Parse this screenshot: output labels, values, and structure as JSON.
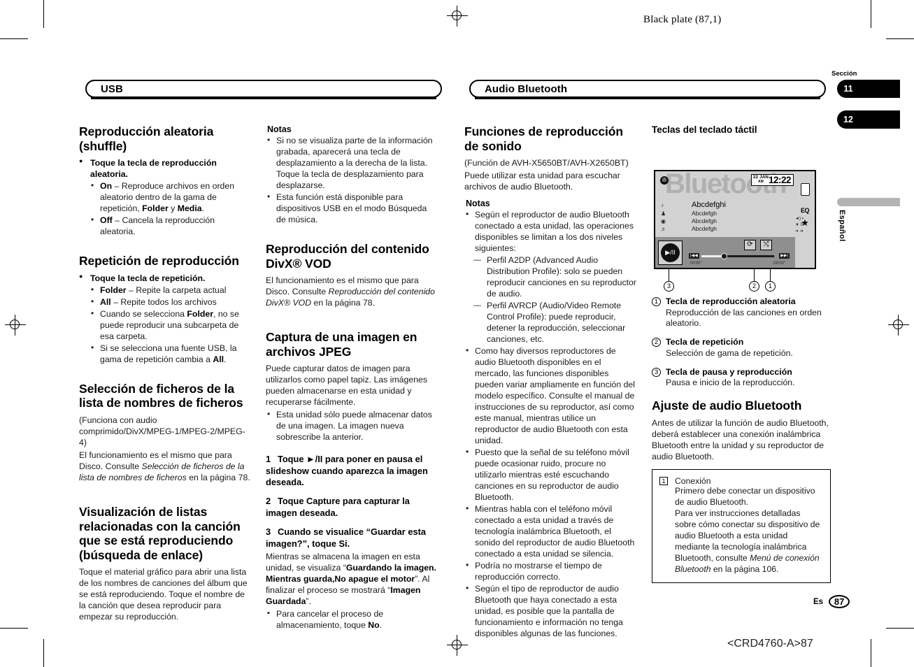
{
  "print": {
    "plate": "Black plate (87,1)",
    "footer_code": "<CRD4760-A>87"
  },
  "margin": {
    "seccion_label": "Sección",
    "tabs": [
      "11",
      "12"
    ],
    "language": "Español"
  },
  "page_footer": {
    "lang": "Es",
    "number": "87"
  },
  "banners": {
    "left": "USB",
    "right": "Audio Bluetooth"
  },
  "col1": {
    "h_shuffle": "Reproducción aleatoria (shuffle)",
    "shuffle_bullet": "Toque la tecla de reproducción aleatoria.",
    "shuffle_on_bold": "On",
    "shuffle_on_rest": " – Reproduce archivos en orden aleatorio dentro de la gama de repetición, ",
    "shuffle_on_b2": "Folder",
    "shuffle_on_mid": " y ",
    "shuffle_on_b3": "Media",
    "shuffle_on_end": ".",
    "shuffle_off_bold": "Off",
    "shuffle_off_rest": " – Cancela la reproducción aleatoria.",
    "h_repeat": "Repetición de reproducción",
    "repeat_bullet": "Toque la tecla de repetición.",
    "rep_folder_b": "Folder",
    "rep_folder_r": " – Repite la carpeta actual",
    "rep_all_b": "All",
    "rep_all_r": " – Repite todos los archivos",
    "rep_note1_a": "Cuando se selecciona ",
    "rep_note1_b": "Folder",
    "rep_note1_c": ", no se puede reproducir una subcarpeta de esa carpeta.",
    "rep_note2_a": "Si se selecciona una fuente USB, la gama de repetición cambia a ",
    "rep_note2_b": "All",
    "rep_note2_c": ".",
    "h_select": "Selección de ficheros de la lista de nombres de ficheros",
    "select_p1": "(Funciona con audio comprimido/DivX/MPEG-1/MPEG-2/MPEG-4)",
    "select_p2": "El funcionamiento es el mismo que para Disco. Consulte ",
    "select_p2_it": "Selección de ficheros de la lista de nombres de ficheros",
    "select_p2_end": " en la página 78.",
    "h_link": "Visualización de listas relacionadas con la canción que se está reproduciendo (búsqueda de enlace)",
    "link_p": "Toque el material gráfico para abrir una lista de los nombres de canciones del álbum que se está reproduciendo. Toque el nombre de la canción que desea reproducir para empezar su reproducción."
  },
  "col2": {
    "notas": "Notas",
    "note1": "Si no se visualiza parte de la información grabada, aparecerá una tecla de desplazamiento a la derecha de la lista. Toque la tecla de desplazamiento para desplazarse.",
    "note2": "Esta función está disponible para dispositivos USB en el modo Búsqueda de música.",
    "h_divx": "Reproducción del contenido DivX® VOD",
    "divx_p_a": "El funcionamiento es el mismo que para Disco. Consulte ",
    "divx_p_it": "Reproducción del contenido DivX® VOD",
    "divx_p_end": " en la página 78.",
    "h_jpeg": "Captura de una imagen en archivos JPEG",
    "jpeg_p": "Puede capturar datos de imagen para utilizarlos como papel tapiz. Las imágenes pueden almacenarse en esta unidad y recuperarse fácilmente.",
    "jpeg_bullet": "Esta unidad sólo puede almacenar datos de una imagen. La imagen nueva sobrescribe la anterior.",
    "step1_num": "1",
    "step1": "Toque ►/II para poner en pausa el slideshow cuando aparezca la imagen deseada.",
    "step2_num": "2",
    "step2": "Toque Capture para capturar la imagen deseada.",
    "step3_num": "3",
    "step3": "Cuando se visualice “Guardar esta imagen?”, toque Si.",
    "step3_p_a": "Mientras se almacena la imagen en esta unidad, se visualiza “",
    "step3_p_b": "Guardando la imagen. Mientras guarda,No apague el motor",
    "step3_p_c": "”. Al finalizar el proceso se mostrará “",
    "step3_p_d": "Imagen Guardada",
    "step3_p_e": "”.",
    "step3_cancel_a": "Para cancelar el proceso de almacenamiento, toque ",
    "step3_cancel_b": "No",
    "step3_cancel_c": "."
  },
  "col3": {
    "h_sound": "Funciones de reproducción de sonido",
    "sound_p1": "(Función de AVH-X5650BT/AVH-X2650BT)",
    "sound_p2": "Puede utilizar esta unidad para escuchar archivos de audio Bluetooth.",
    "notas": "Notas",
    "note1": "Según el reproductor de audio Bluetooth conectado a esta unidad, las operaciones disponibles se limitan a los dos niveles siguientes:",
    "note1_dash1": "Perfil A2DP (Advanced Audio Distribution Profile): solo se pueden reproducir canciones en su reproductor de audio.",
    "note1_dash2": "Perfil AVRCP (Audio/Video Remote Control Profile): puede reproducir, detener la reproducción, seleccionar canciones, etc.",
    "note2": "Como hay diversos reproductores de audio Bluetooth disponibles en el mercado, las funciones disponibles pueden variar ampliamente en función del modelo específico. Consulte el manual de instrucciones de su reproductor, así como este manual, mientras utilice un reproductor de audio Bluetooth con esta unidad.",
    "note3": "Puesto que la señal de su teléfono móvil puede ocasionar ruido, procure no utilizarlo mientras esté escuchando canciones en su reproductor de audio Bluetooth.",
    "note4": "Mientras habla con el teléfono móvil conectado a esta unidad a través de tecnología inalámbrica Bluetooth, el sonido del reproductor de audio Bluetooth conectado a esta unidad se silencia.",
    "note5": "Podría no mostrarse el tiempo de reproducción correcto.",
    "note6": "Según el tipo de reproductor de audio Bluetooth que haya conectado a esta unidad, es posible que la pantalla de funcionamiento e información no tenga disponibles algunas de las funciones."
  },
  "col4": {
    "h_keys": "Teclas del teclado táctil",
    "callouts": [
      {
        "num": "①",
        "title": "Tecla de reproducción aleatoria",
        "desc": "Reproducción de las canciones en orden aleatorio."
      },
      {
        "num": "②",
        "title": "Tecla de repetición",
        "desc": "Selección de gama de repetición."
      },
      {
        "num": "③",
        "title": "Tecla de pausa y reproducción",
        "desc": "Pausa e inicio de la reproducción."
      }
    ],
    "h_adjust": "Ajuste de audio Bluetooth",
    "adjust_p": "Antes de utilizar la función de audio Bluetooth, deberá establecer una conexión inalámbrica Bluetooth entre la unidad y su reproductor de audio Bluetooth.",
    "box_num": "1",
    "box_title": "Conexión",
    "box_p1": "Primero debe conectar un dispositivo de audio Bluetooth.",
    "box_p2_a": "Para ver instrucciones detalladas sobre cómo conectar su dispositivo de audio Bluetooth a esta unidad mediante la tecnología inalámbrica Bluetooth, consulte ",
    "box_p2_it": "Menú de conexión Bluetooth",
    "box_p2_end": " en la página 106."
  },
  "device": {
    "watermark": "Bluetooth",
    "bt_icon": "✇",
    "date": "22 JAN",
    "ampm": "AM",
    "time": "12:22",
    "note_icon": "♪",
    "rows": [
      {
        "icon": "♪",
        "text": "Abcdefghi"
      },
      {
        "icon": "♟",
        "text": "Abcdefgh"
      },
      {
        "icon": "◉",
        "text": "Abcdefgh"
      },
      {
        "icon": "♬",
        "text": "Abcdefgh"
      }
    ],
    "eq_label": "EQ",
    "star": "★",
    "play_glyph": "▶/II",
    "repeat_glyph": "⟳",
    "shuffle_glyph": "⤭",
    "prev_glyph": "|◀◀",
    "next_glyph": "▶▶|",
    "time_elapsed": "00'00\"",
    "time_remain": "-00'00\"",
    "callout_marks": [
      "③",
      "②",
      "①"
    ]
  }
}
